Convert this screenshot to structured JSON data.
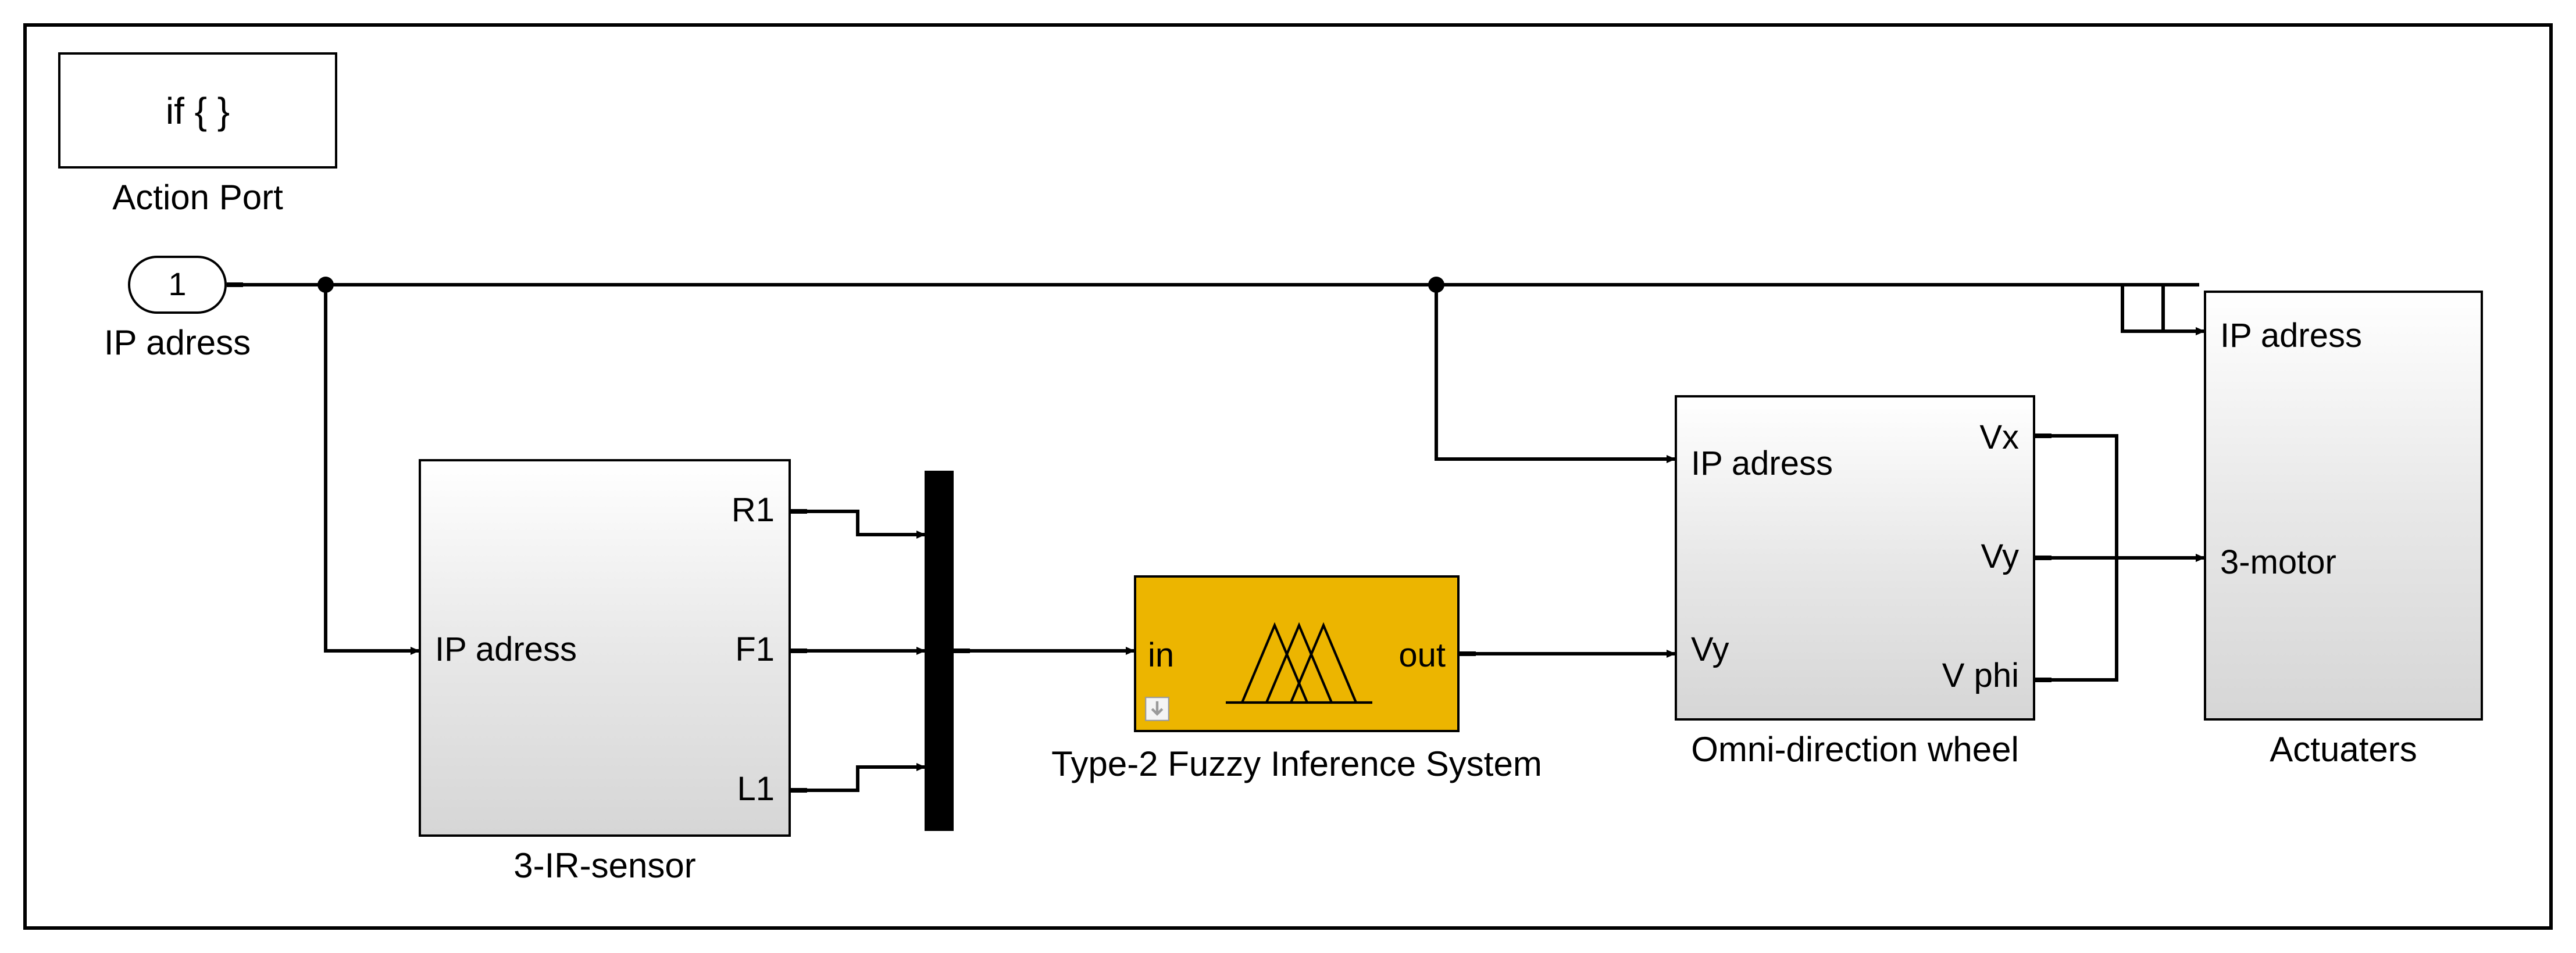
{
  "action_port": {
    "text": "if { }",
    "label": "Action Port"
  },
  "inport": {
    "number": "1",
    "label": "IP adress"
  },
  "ir_sensor": {
    "label": "3-IR-sensor",
    "in": "IP adress",
    "out1": "R1",
    "out2": "F1",
    "out3": "L1"
  },
  "fuzzy": {
    "label": "Type-2 Fuzzy Inference System",
    "in": "in",
    "out": "out"
  },
  "omni": {
    "label": "Omni-direction wheel",
    "in1": "IP adress",
    "in2": "Vy",
    "out1": "Vx",
    "out2": "Vy",
    "out3": "V phi"
  },
  "actuators": {
    "label": "Actuaters",
    "in1": "IP adress",
    "in2": "3-motor"
  },
  "colors": {
    "fuzzy_bg": "#ecb500"
  }
}
